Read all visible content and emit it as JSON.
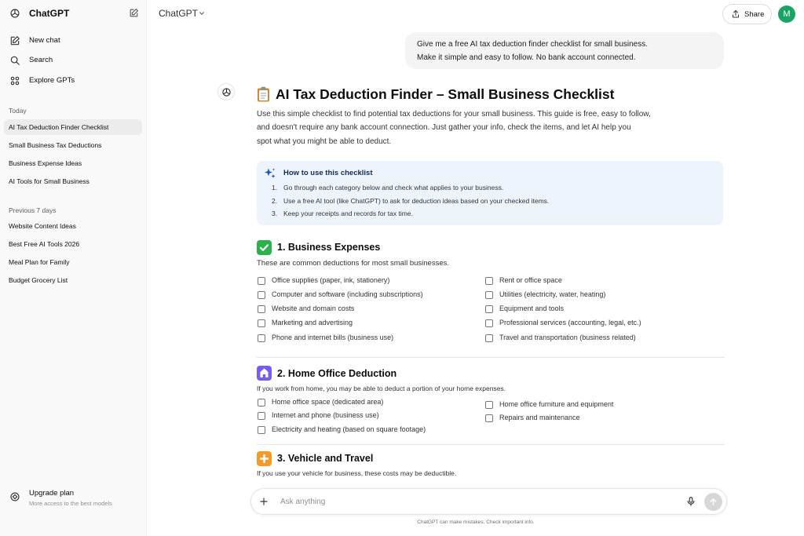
{
  "sidebar": {
    "app_title": "ChatGPT",
    "nav": [
      {
        "label": "New chat",
        "icon": "new-chat-icon"
      },
      {
        "label": "Search",
        "icon": "search-icon"
      },
      {
        "label": "Explore GPTs",
        "icon": "grid-icon"
      }
    ],
    "today_label": "Today",
    "today": [
      "AI Tax Deduction Finder Checklist",
      "Small Business Tax Deductions",
      "Business Expense Ideas",
      "AI Tools for Small Business"
    ],
    "prev_label": "Previous 7 days",
    "previous": [
      "Website Content Ideas",
      "Best Free AI Tools 2026",
      "Meal Plan for Family",
      "Budget Grocery List"
    ],
    "upgrade_title": "Upgrade plan",
    "upgrade_sub": "More access to the best models"
  },
  "header": {
    "model": "ChatGPT",
    "share": "Share",
    "avatar": "M"
  },
  "user_message": {
    "line1": "Give me a free AI tax deduction finder checklist for small business.",
    "line2": "Make it simple and easy to follow. No bank account connected."
  },
  "response": {
    "title": "AI Tax Deduction Finder – Small Business Checklist",
    "intro": [
      "Use this simple checklist to find potential tax deductions for your small business. This guide is free, easy to follow,",
      "and doesn't require any bank account connection. Just gather your info, check the items, and let AI help you",
      "spot what you might be able to deduct."
    ],
    "howto": {
      "title": "How to use this checklist",
      "steps": [
        "Go through each category below and check what applies to your business.",
        "Use a free AI tool (like ChatGPT) to ask for deduction ideas based on your checked items.",
        "Keep your receipts and records for tax time."
      ]
    },
    "sections": [
      {
        "title": "1. Business Expenses",
        "subtitle": "These are common deductions for most small businesses.",
        "left": [
          "Office supplies (paper, ink, stationery)",
          "Computer and software (including subscriptions)",
          "Website and domain costs",
          "Marketing and advertising",
          "Phone and internet bills (business use)"
        ],
        "right": [
          "Rent or office space",
          "Utilities (electricity, water, heating)",
          "Equipment and tools",
          "Professional services (accounting, legal, etc.)",
          "Travel and transportation (business related)"
        ]
      },
      {
        "title": "2. Home Office Deduction",
        "subtitle": "If you work from home, you may be able to deduct a portion of your home expenses.",
        "left": [
          "Home office space (dedicated area)",
          "Internet and phone (business use)",
          "Electricity and heating (based on square footage)"
        ],
        "right": [
          "Home office furniture and equipment",
          "Repairs and maintenance"
        ]
      },
      {
        "title": "3. Vehicle and Travel",
        "subtitle": "If you use your vehicle for business, these costs may be deductible."
      }
    ]
  },
  "composer": {
    "placeholder": "Ask anything"
  },
  "disclaimer": "ChatGPT can make mistakes. Check important info.",
  "colors": {
    "sidebar_bg": "#f9f9f9",
    "active_item": "#ececec",
    "avatar": "#19a463",
    "howto_bg": "#eef4fc",
    "section1_badge": "#2bb24c",
    "section2_badge": "#7b5cf0",
    "section3_badge": "#f59a2a"
  }
}
